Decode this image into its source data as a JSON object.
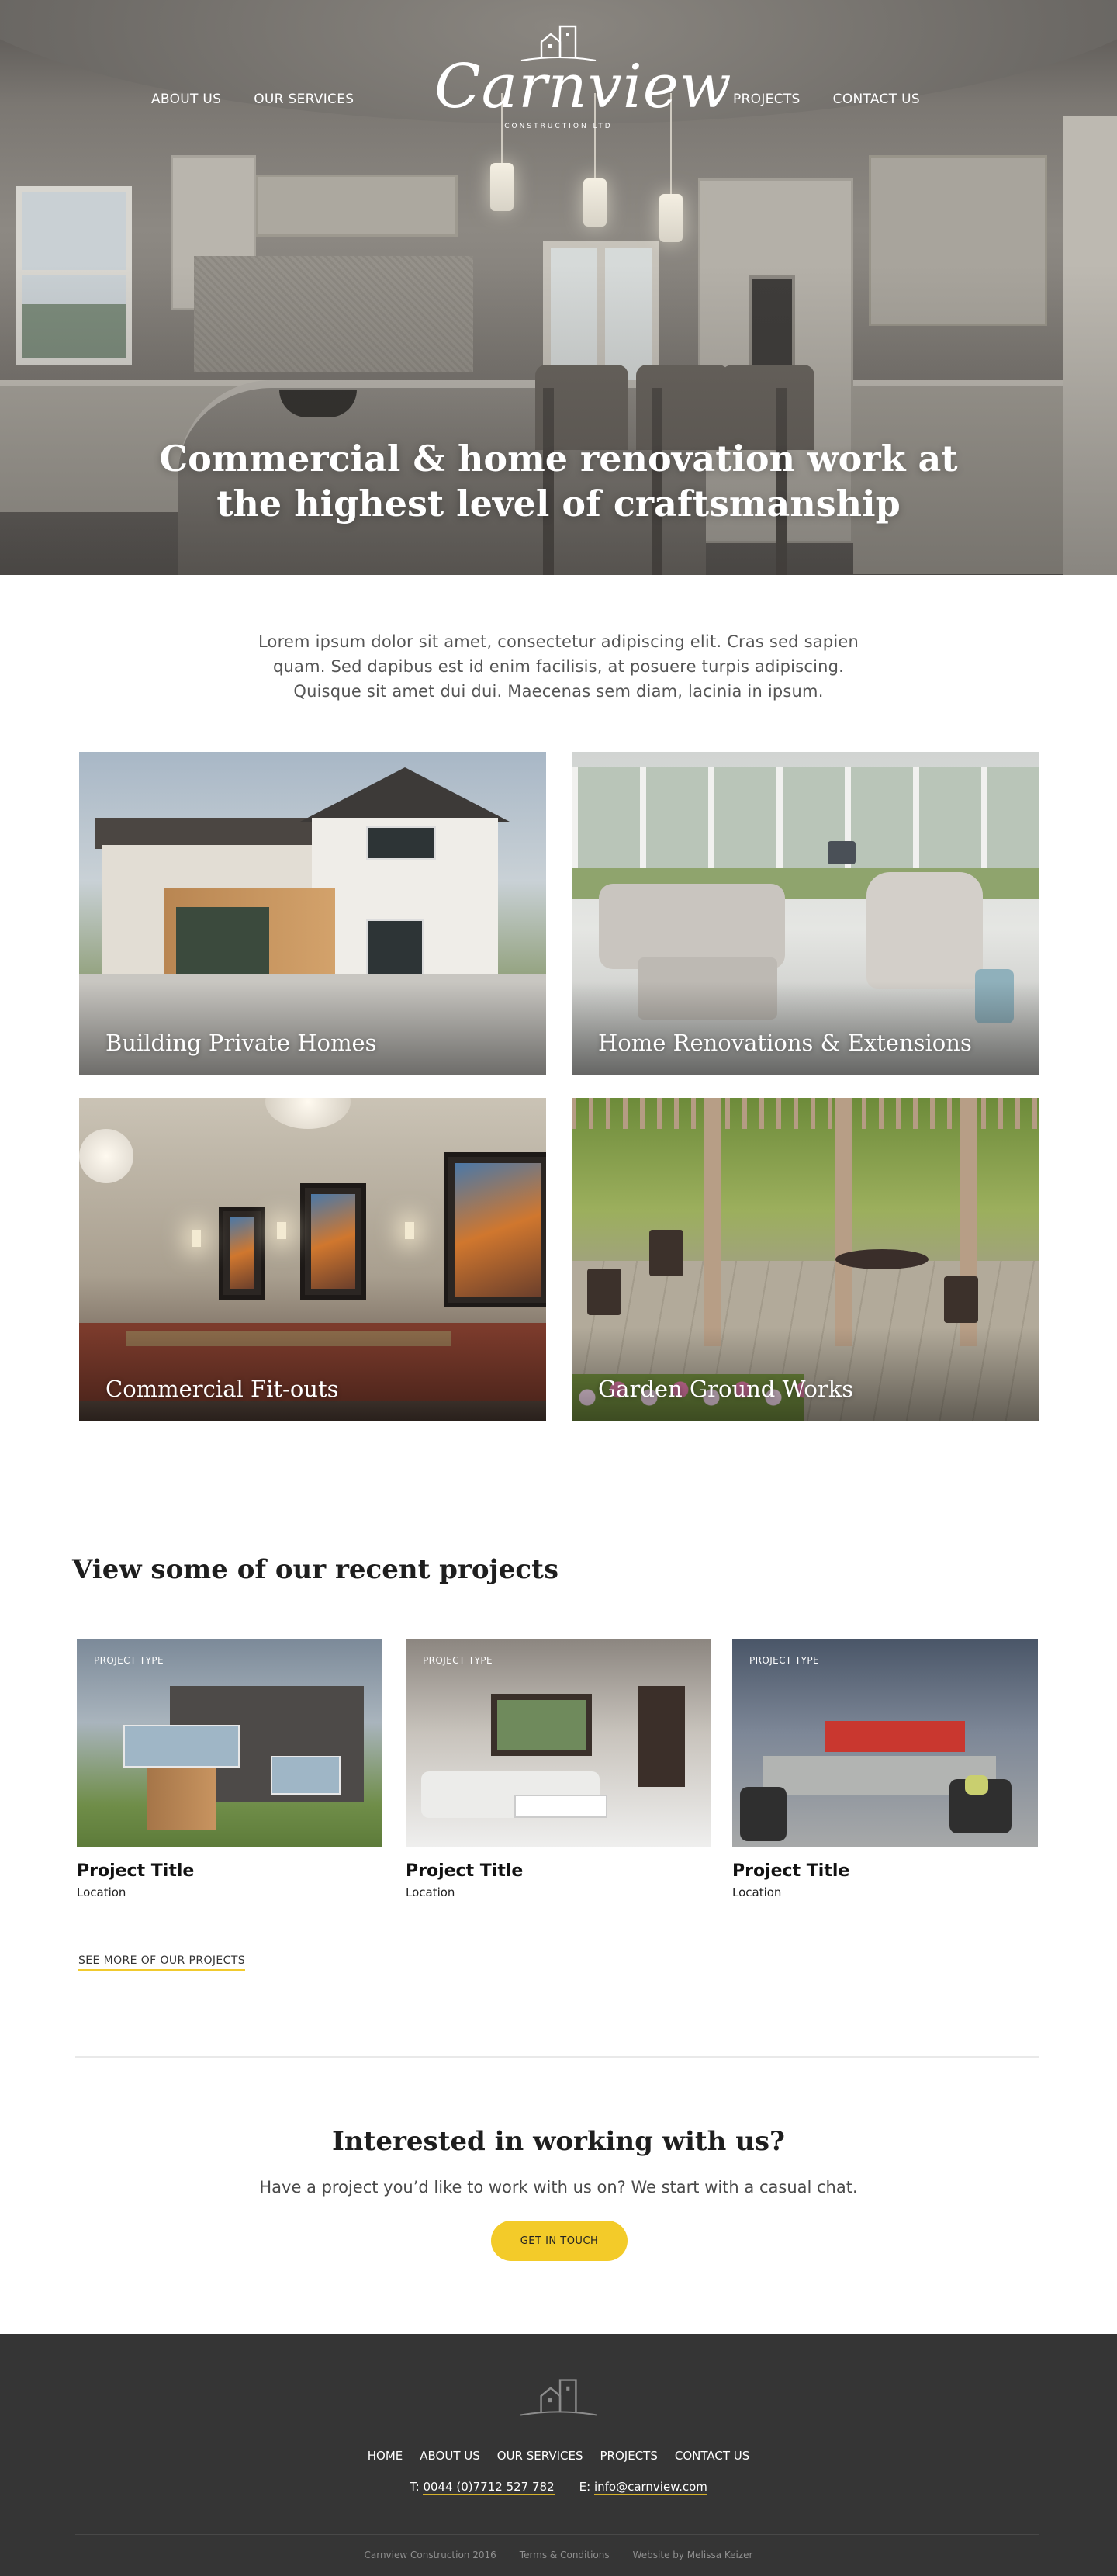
{
  "nav": {
    "left": [
      "ABOUT US",
      "OUR SERVICES"
    ],
    "right": [
      "PROJECTS",
      "CONTACT US"
    ]
  },
  "logo": {
    "wordmark": "Carnview",
    "tagline": "CONSTRUCTION LTD",
    "icon": "house-outline-icon"
  },
  "hero": {
    "title_line1": "Commercial & home renovation work at",
    "title_line2": "the highest level of craftsmanship"
  },
  "intro": {
    "text": "Lorem ipsum dolor sit amet, consectetur adipiscing elit. Cras sed sapien quam. Sed dapibus est id enim facilisis, at posuere turpis adipiscing. Quisque sit amet dui dui. Maecenas sem diam, lacinia in ipsum."
  },
  "services": [
    {
      "label": "Building Private Homes"
    },
    {
      "label": "Home Renovations & Extensions"
    },
    {
      "label": "Commercial Fit-outs"
    },
    {
      "label": "Garden Ground Works"
    }
  ],
  "projects": {
    "heading": "View some of our recent projects",
    "items": [
      {
        "type": "PROJECT TYPE",
        "title": "Project Title",
        "location": "Location"
      },
      {
        "type": "PROJECT TYPE",
        "title": "Project Title",
        "location": "Location"
      },
      {
        "type": "PROJECT TYPE",
        "title": "Project Title",
        "location": "Location"
      }
    ],
    "see_more": "SEE MORE OF OUR PROJECTS"
  },
  "cta": {
    "title": "Interested in working with us?",
    "subtitle": "Have a project you’d like to work with us on? We start with a casual chat.",
    "button": "GET IN TOUCH"
  },
  "footer": {
    "nav": [
      "HOME",
      "ABOUT US",
      "OUR SERVICES",
      "PROJECTS",
      "CONTACT US"
    ],
    "phone_prefix": "T:",
    "phone": "0044 (0)7712 527 782",
    "email_prefix": "E:",
    "email": "info@carnview.com",
    "copyright": "Carnview Construction 2016",
    "terms": "Terms & Conditions",
    "credit": "Website by Melissa Keizer"
  },
  "colors": {
    "accent": "#f3cb29",
    "footer_bg": "#353535",
    "text_dark": "#1e1e1e"
  }
}
